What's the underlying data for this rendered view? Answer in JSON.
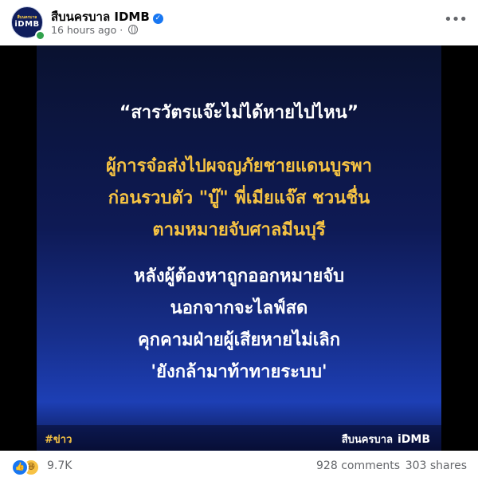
{
  "post": {
    "page_name": "สืบนครบาล IDMB",
    "avatar_small_text": "สืบนครบาล",
    "avatar_main_text": "iDMB",
    "timestamp": "16 hours ago",
    "separator": "·"
  },
  "poster": {
    "quote": "“สารวัตรแจ๊ะไม่ได้หายไปไหน”",
    "yellow_lines": [
      "ผู้การจ๋อส่งไปผจญภัยชายแดนบูรพา",
      "ก่อนรวบตัว \"บู๊\" พี่เมียแจ๊ส ชวนชื่น",
      "ตามหมายจับศาลมีนบุรี"
    ],
    "white_lines": [
      "หลังผู้ต้องหาถูกออกหมายจับ",
      "นอกจากจะไลฟ์สด",
      "คุกคามฝ่ายผู้เสียหายไม่เลิก",
      "'ยังกล้ามาท้าทายระบบ'"
    ],
    "tag": "#ข่าว",
    "brand_name": "สืบนครบาล",
    "brand_mark": "iDMB"
  },
  "stats": {
    "reactions_count": "9.7K",
    "comments": "928 comments",
    "shares": "303 shares"
  },
  "colors": {
    "poster_yellow": "#f6c343",
    "poster_blue": "#172f8c",
    "verified_blue": "#1877f2"
  }
}
